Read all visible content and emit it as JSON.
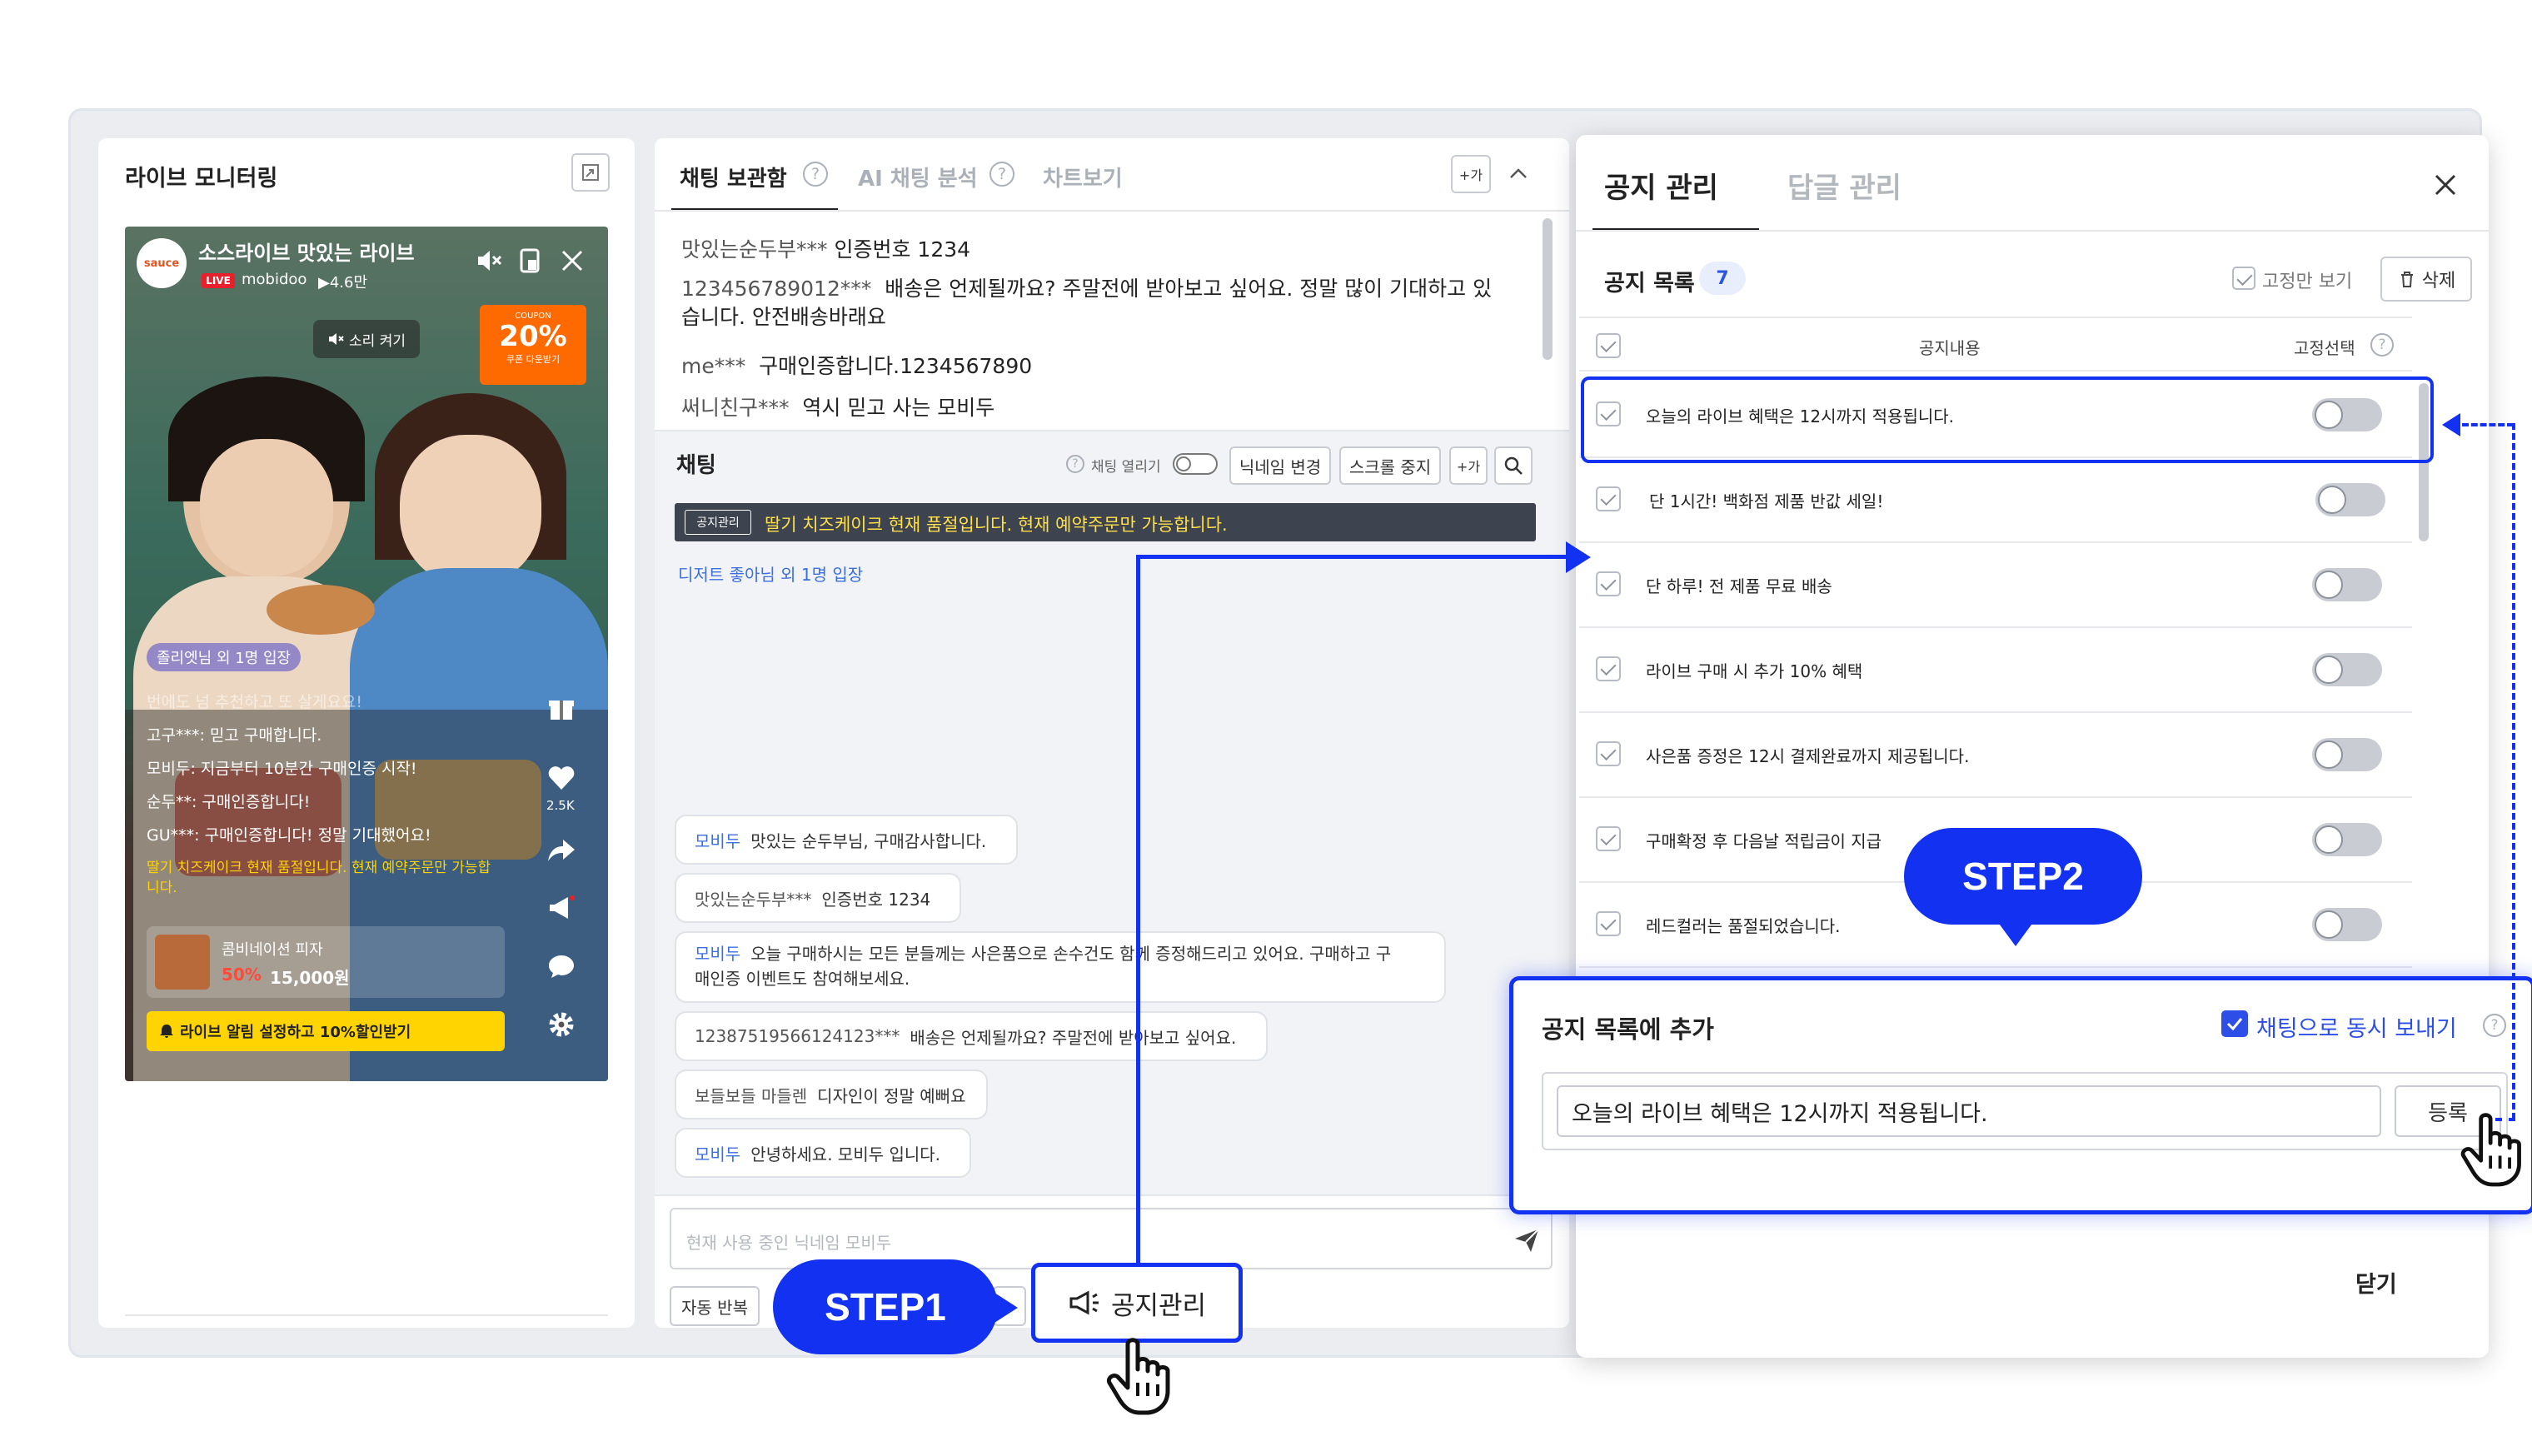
{
  "live_monitor": {
    "title": "라이브 모니터링",
    "video": {
      "brand": "sauce",
      "live_title": "소스라이브 맛있는 라이브",
      "live_badge": "LIVE",
      "host": "mobidoo",
      "views": "▶4.6만",
      "sound_on": "소리 켜기",
      "coupon_label": "COUPON",
      "coupon_value": "20%",
      "coupon_sub": "쿠폰 다운받기",
      "entry": "졸리엣님 외 1명 입장",
      "chat_lines": [
        "번에도 넘 추천하고 또 살게요요!",
        "고구***: 믿고 구매합니다.",
        "모비두: 지금부터 10분간 구매인증 시작!",
        "순두**: 구매인증합니다!",
        "GU***: 구매인증합니다! 정말 기대했어요!"
      ],
      "notice": "딸기 치즈케이크 현재 품절입니다. 현재 예약주문만 가능합니다.",
      "like_count": "2.5K",
      "product_name": "콤비네이션 피자",
      "product_discount": "50%",
      "product_price": "15,000원",
      "alert_button": "라이브 알림 설정하고 10%할인받기"
    }
  },
  "chat_panel": {
    "tabs": [
      "채팅 보관함",
      "AI 채팅 분석",
      "차트보기"
    ],
    "archive": [
      {
        "nick": "맛있는순두부***",
        "text": "인증번호 1234"
      },
      {
        "nick": "123456789012***",
        "text": "배송은 언제될까요? 주말전에 받아보고 싶어요. 정말 많이 기대하고 있습니다. 안전배송바래요"
      },
      {
        "nick": "me***",
        "text": "구매인증합니다.1234567890"
      },
      {
        "nick": "써니친구***",
        "text": "역시 믿고 사는 모비두"
      }
    ],
    "chat_title": "채팅",
    "chat_open_label": "채팅 열리기",
    "btn_nickname": "닉네임 변경",
    "btn_scroll_stop": "스크롤 중지",
    "btn_font": "+가",
    "notice_badge": "공지관리",
    "notice_text": "딸기 치즈케이크 현재 품절입니다. 현재 예약주문만 가능합니다.",
    "entry_text": "디저트 좋아님 외 1명 입장",
    "messages": [
      {
        "nick": "모비두",
        "text": "맛있는 순두부님, 구매감사합니다."
      },
      {
        "nick": "맛있는순두부***",
        "text": "인증번호 1234"
      },
      {
        "nick": "모비두",
        "text": "오늘 구매하시는 모든 분들께는 사은품으로 손수건도 함께 증정해드리고 있어요. 구매하고 구",
        "text2": "매인증 이벤트도 참여해보세요."
      },
      {
        "nick": "12387519566124123***",
        "text": "배송은 언제될까요? 주말전에 받아보고 싶어요."
      },
      {
        "nick": "보들보들 마들렌",
        "text": "디자인이 정말 예뻐요"
      },
      {
        "nick": "모비두",
        "text": "안녕하세요. 모비두 입니다."
      }
    ],
    "input_placeholder": "현재 사용 중인 닉네임 모비두",
    "btn_auto_repeat": "자동 반복",
    "notice_manage_button": "공지관리"
  },
  "notice_panel": {
    "tab_notice": "공지 관리",
    "tab_reply": "답글 관리",
    "list_title": "공지 목록",
    "list_count": "7",
    "fixed_only": "고정만 보기",
    "delete": "삭제",
    "col_content": "공지내용",
    "col_pin": "고정선택",
    "items": [
      "오늘의 라이브 혜택은 12시까지 적용됩니다.",
      "단 1시간! 백화점 제품 반값 세일!",
      "단 하루! 전 제품 무료 배송",
      "라이브 구매 시 추가 10% 혜택",
      "사은품 증정은 12시 결제완료까지 제공됩니다.",
      "구매확정 후 다음날 적립금이 지급",
      "레드컬러는 품절되었습니다."
    ],
    "close": "닫기"
  },
  "add_notice": {
    "title": "공지 목록에 추가",
    "send_with_chat": "채팅으로 동시 보내기",
    "input_value": "오늘의 라이브 혜택은 12시까지 적용됩니다.",
    "register": "등록"
  },
  "steps": {
    "step1": "STEP1",
    "step2": "STEP2"
  },
  "colors": {
    "accent": "#1331f0",
    "coupon": "#ff6a00",
    "alert_yellow": "#ffd400",
    "link_blue": "#3b6fe0"
  }
}
